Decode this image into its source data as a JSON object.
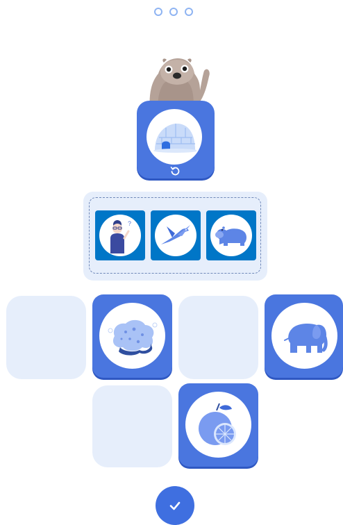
{
  "progress": {
    "total": 3,
    "current": 0
  },
  "colors": {
    "card": "#4a76df",
    "placeholder": "#e6eefb",
    "choice_bg": "#0076c7",
    "dot": "#8fb4f2"
  },
  "icons": {
    "mascot": "beaver-mascot",
    "target": "igloo-icon",
    "replay": "replay-icon",
    "choices": [
      "girl-thinking-icon",
      "swallow-icon",
      "hippo-icon"
    ],
    "grid": [
      "sponge-icon",
      "elephant-icon",
      "grapefruit-icon"
    ],
    "submit": "check-icon"
  }
}
